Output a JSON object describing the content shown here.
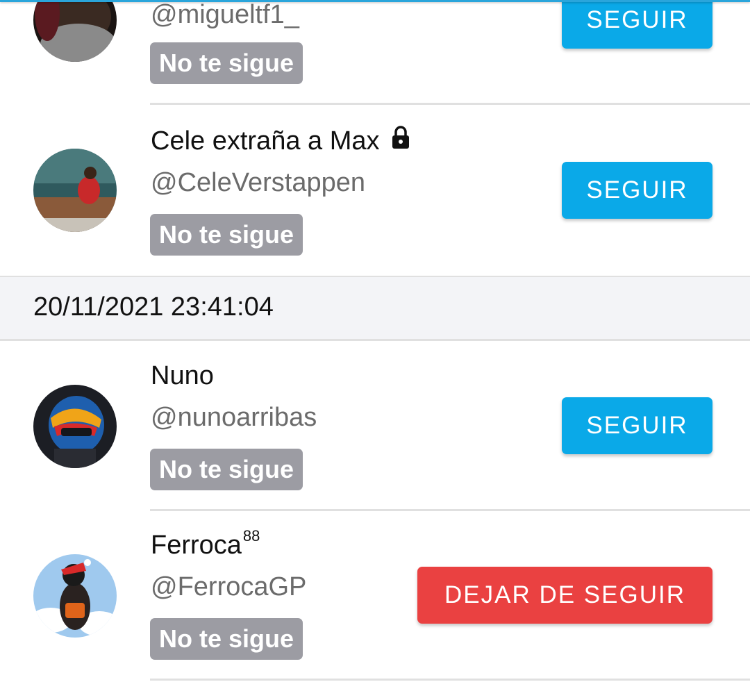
{
  "rows": [
    {
      "name": "",
      "handle": "@migueltf1_",
      "badge": "No te sigue",
      "button": "SEGUIR"
    },
    {
      "name": "Cele extraña a Max",
      "handle": "@CeleVerstappen",
      "badge": "No te sigue",
      "button": "SEGUIR"
    }
  ],
  "section": {
    "date": "20/11/2021 23:41:04"
  },
  "rows2": [
    {
      "name": "Nuno",
      "handle": "@nunoarribas",
      "badge": "No te sigue",
      "button": "SEGUIR"
    },
    {
      "name": "Ferroca",
      "name_sup": "88",
      "handle": "@FerrocaGP",
      "badge": "No te sigue",
      "button": "DEJAR DE SEGUIR"
    }
  ],
  "colors": {
    "follow_button": "#0aa9e8",
    "unfollow_button": "#ea4141",
    "badge": "#9c9ca3",
    "accent": "#2aa5db"
  }
}
